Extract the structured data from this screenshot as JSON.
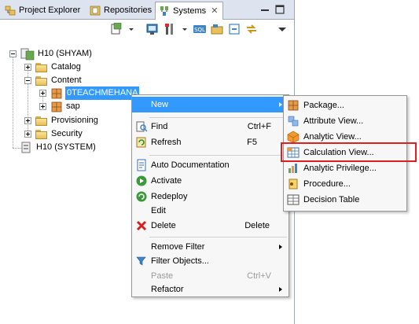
{
  "tabs": [
    {
      "label": "Project Explorer",
      "icon": "project-explorer-icon"
    },
    {
      "label": "Repositories",
      "icon": "repositories-icon"
    },
    {
      "label": "Systems",
      "icon": "systems-icon",
      "active": true
    }
  ],
  "tree": {
    "root": "H10 (SHYAM)",
    "catalog": "Catalog",
    "content": "Content",
    "package1": "0TEACHMEHANA",
    "package2": "sap",
    "provisioning": "Provisioning",
    "security": "Security",
    "root2": "H10 (SYSTEM)"
  },
  "context_menu": {
    "new": "New",
    "find": "Find",
    "find_shortcut": "Ctrl+F",
    "refresh": "Refresh",
    "refresh_shortcut": "F5",
    "auto_doc": "Auto Documentation",
    "activate": "Activate",
    "redeploy": "Redeploy",
    "edit": "Edit",
    "delete": "Delete",
    "delete_shortcut": "Delete",
    "remove_filter": "Remove Filter",
    "filter_objects": "Filter Objects...",
    "paste": "Paste",
    "paste_shortcut": "Ctrl+V",
    "refactor": "Refactor"
  },
  "submenu": {
    "package": "Package...",
    "attribute_view": "Attribute View...",
    "analytic_view": "Analytic View...",
    "calculation_view": "Calculation View...",
    "analytic_privilege": "Analytic Privilege...",
    "procedure": "Procedure...",
    "decision_table": "Decision Table"
  },
  "colors": {
    "selection": "#3399ff",
    "highlight_box": "#e02020",
    "tabbar": "#dde4ef"
  }
}
